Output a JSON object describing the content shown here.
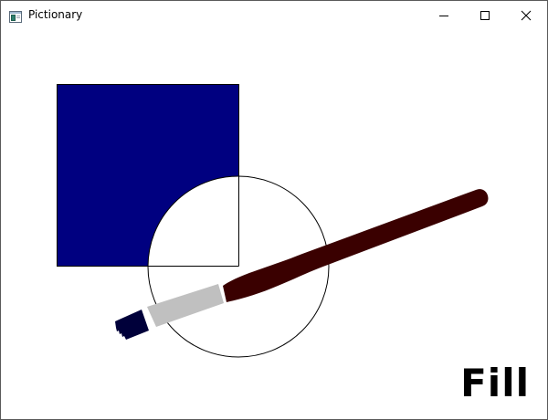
{
  "window": {
    "title": "Pictionary",
    "icon": "app-window-icon",
    "controls": {
      "minimize_icon": "minimize-icon",
      "maximize_icon": "maximize-icon",
      "close_icon": "close-icon"
    }
  },
  "canvas": {
    "background": "#ffffff",
    "shapes": [
      {
        "kind": "square",
        "fill": "#000080",
        "stroke": "#000000"
      },
      {
        "kind": "circle",
        "fill": "#ffffff",
        "stroke": "#000000"
      }
    ],
    "tool": {
      "name": "paintbrush-icon",
      "handle_color": "#3a0000",
      "ferrule_color": "#c0c0c0",
      "bristle_color": "#00003a"
    }
  },
  "mode_label": "Fill"
}
